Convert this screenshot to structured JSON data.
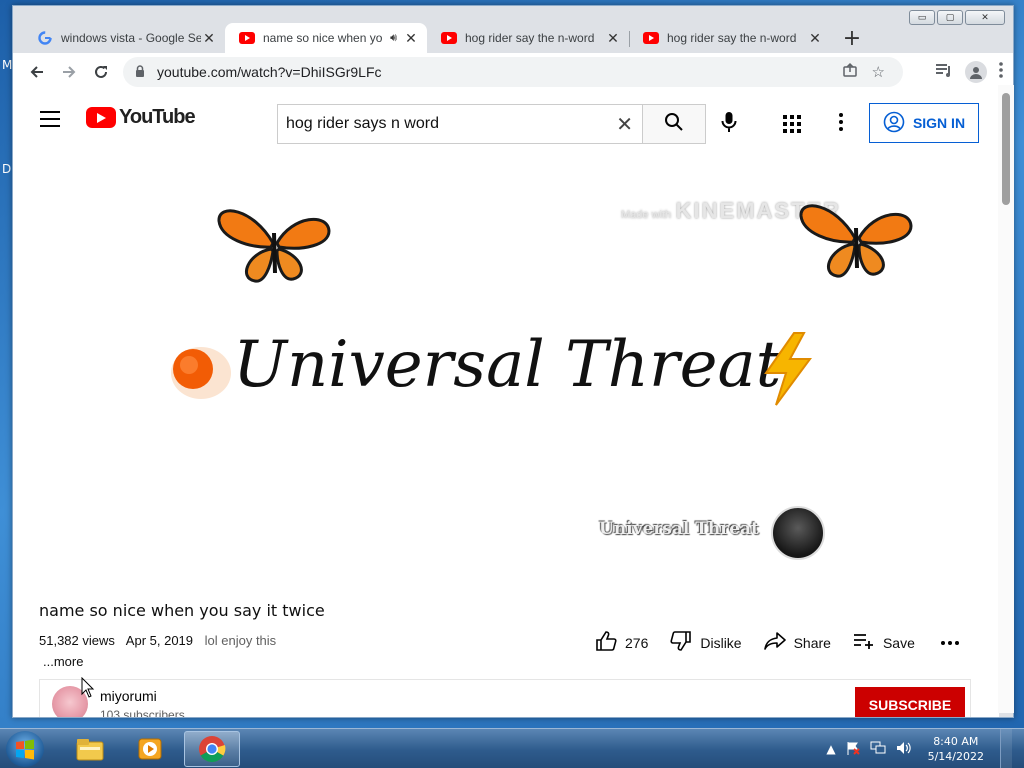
{
  "desktop": {
    "edge_labels": [
      "M",
      "D"
    ]
  },
  "window": {
    "controls": [
      "▭",
      "▢",
      "✕"
    ]
  },
  "tabs": [
    {
      "title": "windows vista - Google Se",
      "favicon": "google-g-icon",
      "active": false
    },
    {
      "title": "name so nice when yo",
      "favicon": "youtube-icon",
      "active": true,
      "audio": true
    },
    {
      "title": "hog rider say the n-word",
      "favicon": "youtube-icon",
      "active": false
    },
    {
      "title": "hog rider say the n-word",
      "favicon": "youtube-icon",
      "active": false
    }
  ],
  "omnibox": {
    "url": "youtube.com/watch?v=DhiISGr9LFc"
  },
  "youtube": {
    "logo_text": "YouTube",
    "search_value": "hog rider says n word",
    "sign_in": "SIGN IN"
  },
  "video": {
    "watermark_small": "Made with",
    "watermark_big": "KINEMASTER",
    "headline": "Universal Threat",
    "channel_watermark": "Universal Threat"
  },
  "meta": {
    "title": "name so nice when you say it twice",
    "views": "51,382 views",
    "date": "Apr 5, 2019",
    "description": "lol enjoy this",
    "more": "...more",
    "likes": "276",
    "dislike": "Dislike",
    "share": "Share",
    "save": "Save"
  },
  "owner": {
    "name": "miyorumi",
    "subscribers": "103 subscribers",
    "subscribe": "SUBSCRIBE"
  },
  "taskbar": {
    "time": "8:40 AM",
    "date": "5/14/2022"
  },
  "colors": {
    "yt_red": "#ff0000",
    "subscribe_red": "#cc0000",
    "link_blue": "#065fd4"
  }
}
